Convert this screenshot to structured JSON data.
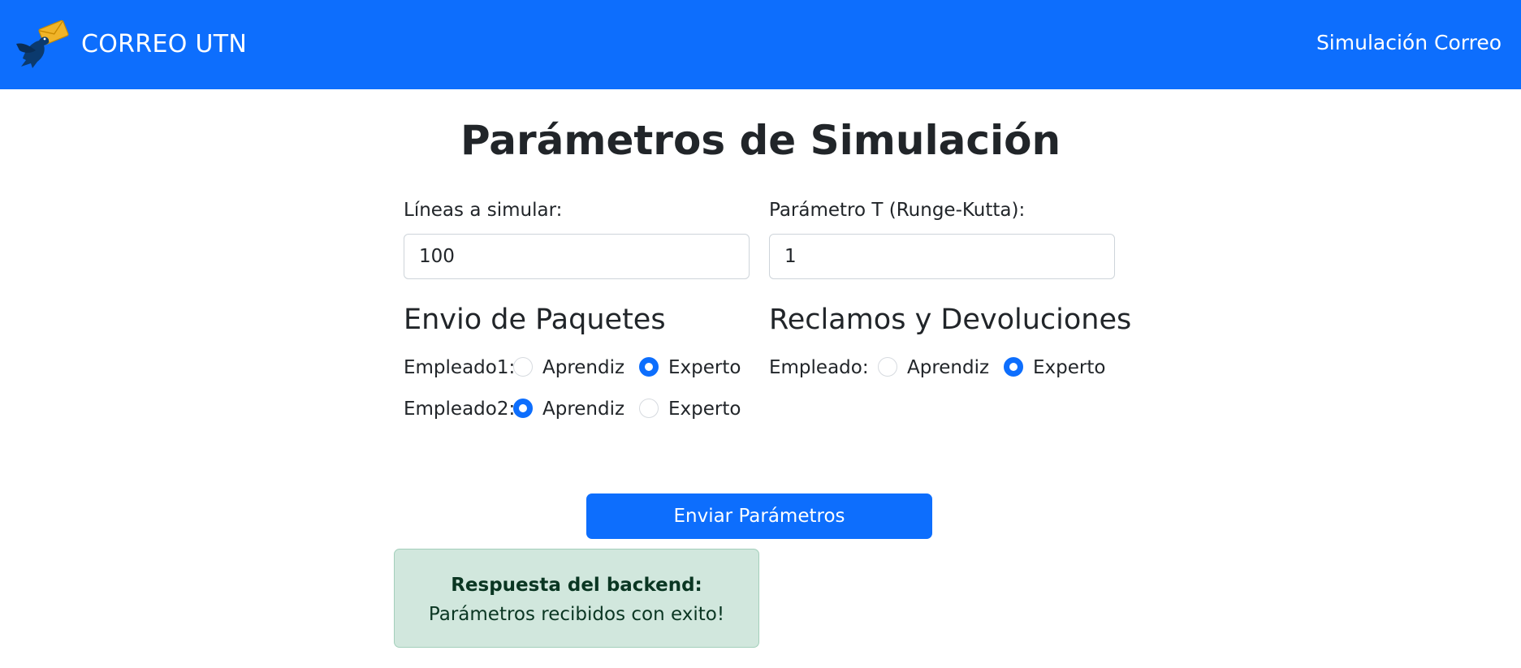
{
  "navbar": {
    "brand_text": "CORREO UTN",
    "link_label": "Simulación Correo",
    "logo_icon": "pigeon-envelope-icon",
    "colors": {
      "background": "#0d6efd",
      "envelope": "#f0b429",
      "bird": "#0b3a6e"
    }
  },
  "page": {
    "title": "Parámetros de Simulación"
  },
  "form": {
    "lines_label": "Líneas a simular:",
    "lines_value": "100",
    "t_label": "Parámetro T (Runge-Kutta):",
    "t_value": "1",
    "envio": {
      "title": "Envio de Paquetes",
      "empleado1": {
        "label": "Empleado1:",
        "option_a": "Aprendiz",
        "option_b": "Experto",
        "selected": "Experto"
      },
      "empleado2": {
        "label": "Empleado2:",
        "option_a": "Aprendiz",
        "option_b": "Experto",
        "selected": "Aprendiz"
      }
    },
    "reclamos": {
      "title": "Reclamos y Devoluciones",
      "empleado": {
        "label": "Empleado:",
        "option_a": "Aprendiz",
        "option_b": "Experto",
        "selected": "Experto"
      }
    },
    "submit_label": "Enviar Parámetros"
  },
  "alert": {
    "strong": "Respuesta del backend:",
    "message": "Parámetros recibidos con exito!",
    "colors": {
      "background": "#d1e7dd",
      "text": "#0a3622"
    }
  }
}
